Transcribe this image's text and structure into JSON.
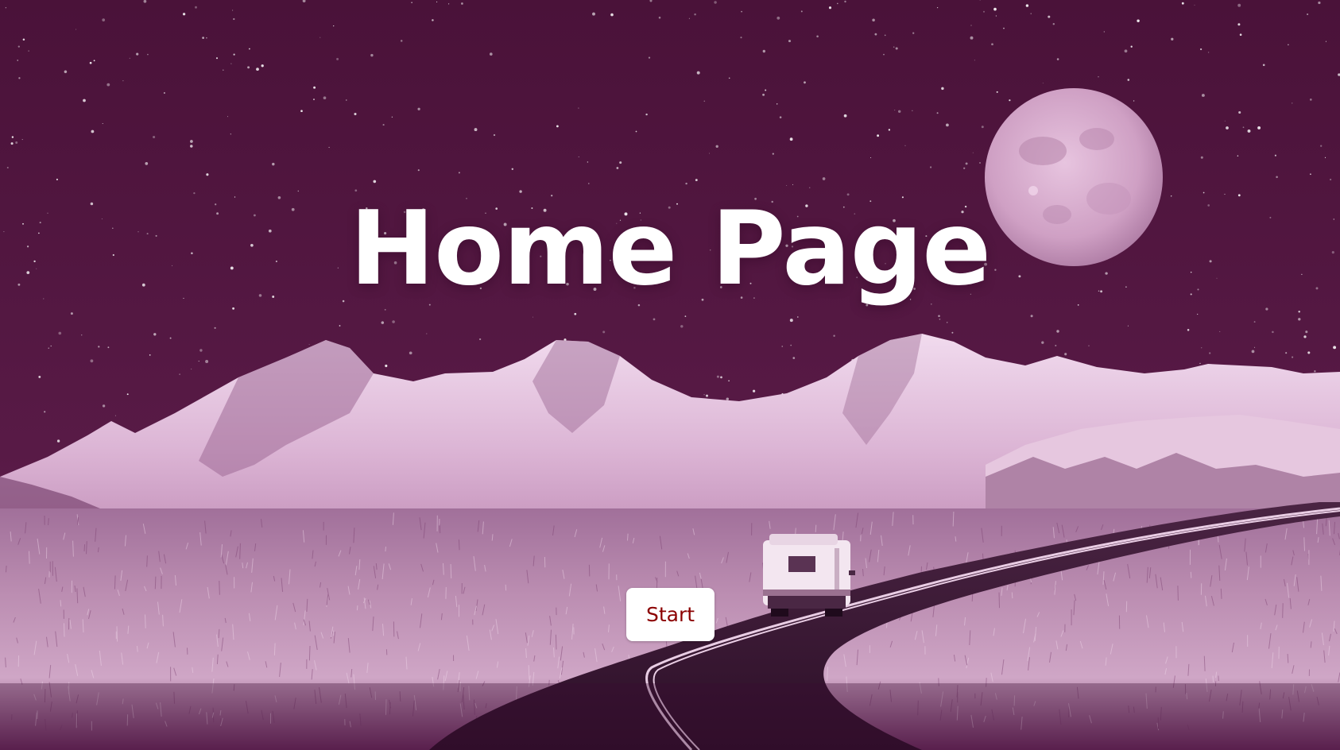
{
  "hero": {
    "title": "Home Page",
    "start_label": "Start"
  },
  "scene": {
    "description_icons": [
      "night-sky",
      "full-moon",
      "snow-mountains",
      "grass-field",
      "winding-road",
      "camper-van"
    ]
  },
  "colors": {
    "sky": "#50163f",
    "moon": "#dcb3d2",
    "snow": "#efd6ea",
    "grass": "#c99bbf",
    "road": "#3a1833",
    "button_text": "#8b0000",
    "button_bg": "#ffffff"
  }
}
